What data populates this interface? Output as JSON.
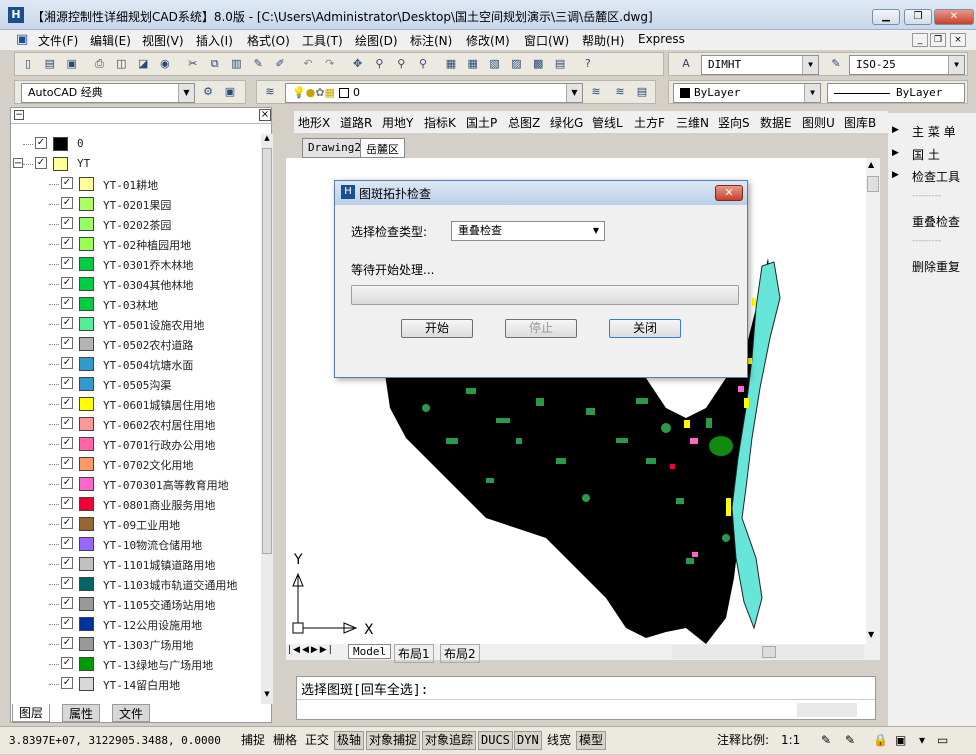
{
  "window": {
    "title": "【湘源控制性详细规划CAD系统】8.0版 - [C:\\Users\\Administrator\\Desktop\\国土空间规划演示\\三调\\岳麓区.dwg]",
    "icon": "app-logo-icon"
  },
  "menu": [
    "文件(F)",
    "编辑(E)",
    "视图(V)",
    "插入(I)",
    "格式(O)",
    "工具(T)",
    "绘图(D)",
    "标注(N)",
    "修改(M)",
    "窗口(W)",
    "帮助(H)",
    "Express"
  ],
  "toolbars": {
    "dimstyle": "DIMHT",
    "textstyle": "ISO-25",
    "workspace": "AutoCAD 经典",
    "layer_value": "0",
    "color": "ByLayer",
    "linetype": "ByLayer"
  },
  "layers": {
    "rows": [
      {
        "name": "0",
        "color": "#000000",
        "tree": "root"
      },
      {
        "name": "YT",
        "color": "#ffff99",
        "tree": "group"
      },
      {
        "name": "YT-01耕地",
        "color": "#ffff99"
      },
      {
        "name": "YT-0201果园",
        "color": "#aaff66"
      },
      {
        "name": "YT-0202茶园",
        "color": "#99ff66"
      },
      {
        "name": "YT-02种植园用地",
        "color": "#99ff55"
      },
      {
        "name": "YT-0301乔木林地",
        "color": "#00cc44"
      },
      {
        "name": "YT-0304其他林地",
        "color": "#00cc44"
      },
      {
        "name": "YT-03林地",
        "color": "#00cc44"
      },
      {
        "name": "YT-0501设施农用地",
        "color": "#55ee99"
      },
      {
        "name": "YT-0502农村道路",
        "color": "#b4b4b4"
      },
      {
        "name": "YT-0504坑塘水面",
        "color": "#3399cc"
      },
      {
        "name": "YT-0505沟渠",
        "color": "#3399cc"
      },
      {
        "name": "YT-0601城镇居住用地",
        "color": "#ffff00"
      },
      {
        "name": "YT-0602农村居住用地",
        "color": "#ff9999"
      },
      {
        "name": "YT-0701行政办公用地",
        "color": "#ff66aa"
      },
      {
        "name": "YT-0702文化用地",
        "color": "#ff9966"
      },
      {
        "name": "YT-070301高等教育用地",
        "color": "#ff66cc"
      },
      {
        "name": "YT-0801商业服务用地",
        "color": "#ee0033"
      },
      {
        "name": "YT-09工业用地",
        "color": "#996633"
      },
      {
        "name": "YT-10物流仓储用地",
        "color": "#9966ff"
      },
      {
        "name": "YT-1101城镇道路用地",
        "color": "#c0c0c0"
      },
      {
        "name": "YT-1103城市轨道交通用地",
        "color": "#006666"
      },
      {
        "name": "YT-1105交通场站用地",
        "color": "#999999"
      },
      {
        "name": "YT-12公用设施用地",
        "color": "#003399"
      },
      {
        "name": "YT-1303广场用地",
        "color": "#999999"
      },
      {
        "name": "YT-13绿地与广场用地",
        "color": "#009900"
      },
      {
        "name": "YT-14留白用地",
        "color": "#d8d8d8"
      }
    ]
  },
  "panel_tabs": [
    "图层",
    "属性",
    "文件"
  ],
  "drawing_nav": [
    "地形X",
    "道路R",
    "用地Y",
    "指标K",
    "国土P",
    "总图Z",
    "绿化G",
    "管线L",
    "土方F",
    "三维N",
    "竖向S",
    "数据E",
    "图则U",
    "图库B"
  ],
  "doc_tabs": [
    "Drawing2",
    "岳麓区"
  ],
  "layout_tabs": [
    "Model",
    "布局1",
    "布局2"
  ],
  "axes": {
    "y": "Y",
    "x": "X"
  },
  "right_panel": [
    "主 菜 单",
    "国    土",
    "检查工具",
    "---------",
    "重叠检查",
    "---------",
    "删除重复"
  ],
  "dialog": {
    "title": "图斑拓扑检查",
    "type_label": "选择检查类型:",
    "type_value": "重叠检查",
    "status": "等待开始处理...",
    "progress": 0,
    "start": "开始",
    "stop": "停止",
    "close": "关闭"
  },
  "command": {
    "prompt": "选择图斑[回车全选]:"
  },
  "status": {
    "coords": "3.8397E+07, 3122905.3488, 0.0000",
    "modes": [
      "捕捉",
      "栅格",
      "正交",
      "极轴",
      "对象捕捉",
      "对象追踪",
      "DUCS",
      "DYN",
      "线宽",
      "模型"
    ],
    "modes_on": [
      false,
      false,
      false,
      true,
      true,
      true,
      true,
      true,
      false,
      true
    ],
    "scale_label": "注释比例:",
    "scale_value": "1:1"
  }
}
